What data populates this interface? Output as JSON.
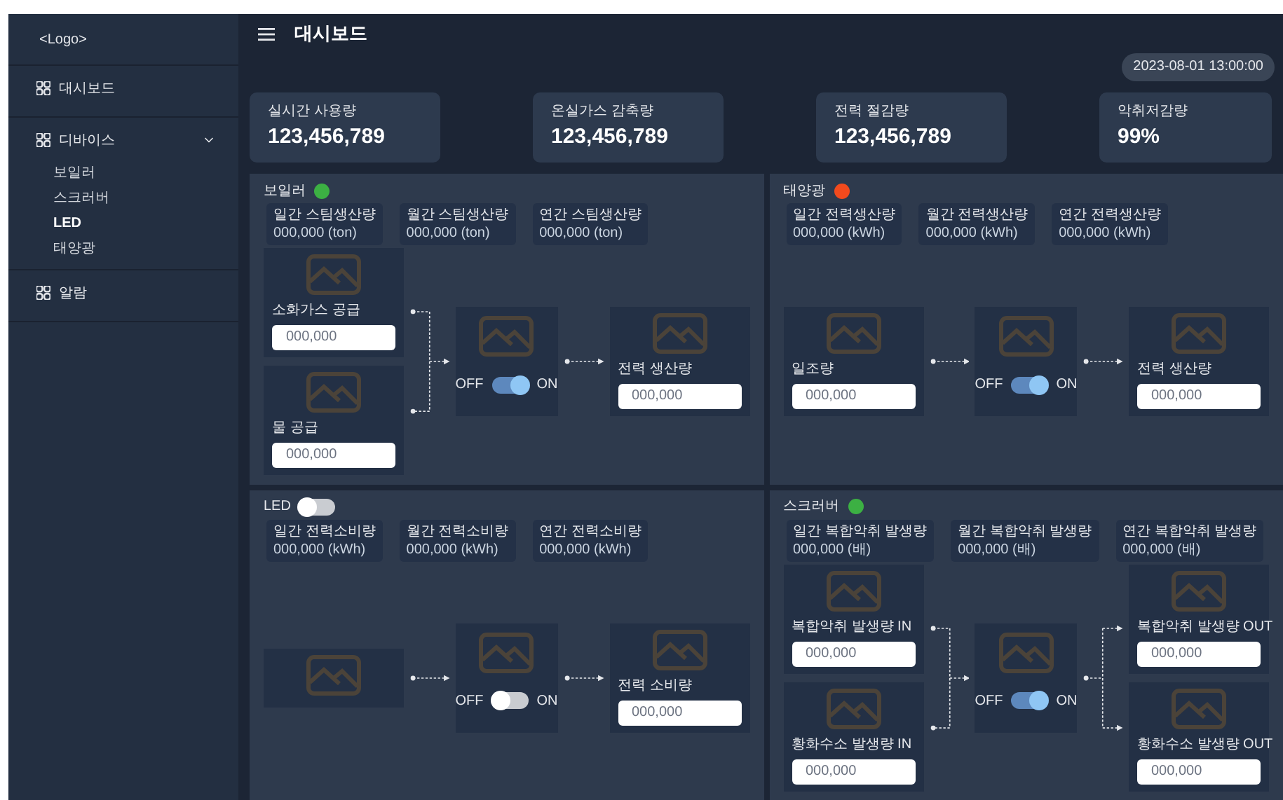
{
  "sidebar": {
    "logo": "<Logo>",
    "items": [
      {
        "label": "대시보드",
        "selected": false
      },
      {
        "label": "디바이스",
        "selected": false,
        "expanded": true,
        "children": [
          {
            "label": "보일러",
            "selected": false
          },
          {
            "label": "스크러버",
            "selected": false
          },
          {
            "label": "LED",
            "selected": true
          },
          {
            "label": "태양광",
            "selected": false
          }
        ]
      },
      {
        "label": "알람",
        "selected": false
      }
    ]
  },
  "header": {
    "title": "대시보드",
    "datetime": "2023-08-01 13:00:00"
  },
  "stats": [
    {
      "label": "실시간 사용량",
      "value": "123,456,789"
    },
    {
      "label": "온실가스 감축량",
      "value": "123,456,789"
    },
    {
      "label": "전력 절감량",
      "value": "123,456,789"
    },
    {
      "label": "악취저감량",
      "value": "99%"
    }
  ],
  "panels": [
    {
      "title": "보일러",
      "status": {
        "kind": "dot",
        "color": "#3cb043"
      },
      "metrics": [
        {
          "label": "일간 스팀생산량",
          "value": "000,000 (ton)"
        },
        {
          "label": "월간 스팀생산량",
          "value": "000,000 (ton)"
        },
        {
          "label": "연간 스팀생산량",
          "value": "000,000 (ton)"
        }
      ],
      "flow": {
        "inputs": [
          {
            "label": "소화가스 공급",
            "placeholder": "000,000"
          },
          {
            "label": "물 공급",
            "placeholder": "000,000"
          }
        ],
        "center": {
          "off_label": "OFF",
          "on_label": "ON",
          "on": true
        },
        "outputs": [
          {
            "label": "전력 생산량",
            "placeholder": "000,000"
          }
        ]
      }
    },
    {
      "title": "태양광",
      "status": {
        "kind": "dot",
        "color": "#f24a1d"
      },
      "metrics": [
        {
          "label": "일간 전력생산량",
          "value": "000,000 (kWh)"
        },
        {
          "label": "월간 전력생산량",
          "value": "000,000 (kWh)"
        },
        {
          "label": "연간 전력생산량",
          "value": "000,000 (kWh)"
        }
      ],
      "flow": {
        "inputs": [
          {
            "label": "일조량",
            "placeholder": "000,000"
          }
        ],
        "center": {
          "off_label": "OFF",
          "on_label": "ON",
          "on": true
        },
        "outputs": [
          {
            "label": "전력 생산량",
            "placeholder": "000,000"
          }
        ]
      }
    },
    {
      "title": "LED",
      "status": {
        "kind": "switch",
        "on": false
      },
      "metrics": [
        {
          "label": "일간 전력소비량",
          "value": "000,000 (kWh)"
        },
        {
          "label": "월간 전력소비량",
          "value": "000,000 (kWh)"
        },
        {
          "label": "연간 전력소비량",
          "value": "000,000 (kWh)"
        }
      ],
      "flow": {
        "center": {
          "off_label": "OFF",
          "on_label": "ON",
          "on": false
        },
        "outputs": [
          {
            "label": "전력 소비량",
            "placeholder": "000,000"
          }
        ]
      }
    },
    {
      "title": "스크러버",
      "status": {
        "kind": "dot",
        "color": "#3cb043"
      },
      "metrics": [
        {
          "label": "일간 복합악취 발생량",
          "value": "000,000 (배)"
        },
        {
          "label": "월간 복합악취 발생량",
          "value": "000,000 (배)"
        },
        {
          "label": "연간 복합악취 발생량",
          "value": "000,000 (배)"
        }
      ],
      "flow": {
        "inputs": [
          {
            "label": "복합악취 발생량 IN",
            "placeholder": "000,000"
          },
          {
            "label": "황화수소 발생량 IN",
            "placeholder": "000,000"
          }
        ],
        "center": {
          "off_label": "OFF",
          "on_label": "ON",
          "on": true
        },
        "outputs": [
          {
            "label": "복합악취 발생량 OUT",
            "placeholder": "000,000"
          },
          {
            "label": "황화수소 발생량 OUT",
            "placeholder": "000,000"
          }
        ]
      }
    }
  ]
}
